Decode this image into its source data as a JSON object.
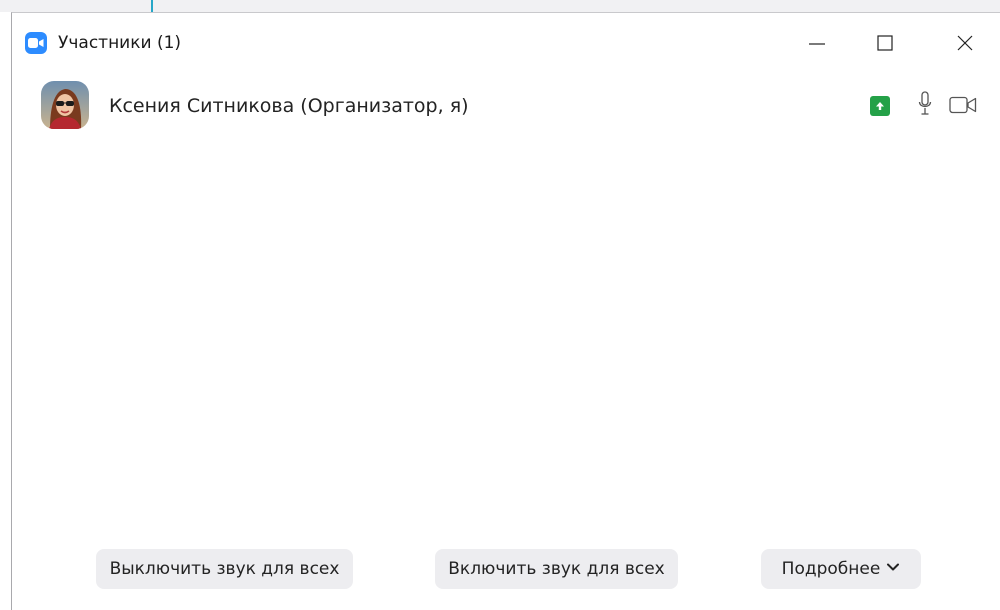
{
  "window": {
    "title": "Участники (1)",
    "icons": {
      "app": "zoom-camera-icon",
      "minimize": "minimize-icon",
      "maximize": "maximize-icon",
      "close": "close-icon"
    }
  },
  "participants": [
    {
      "name": "Ксения Ситникова (Организатор, я)",
      "icons": {
        "avatar": "user-photo-avatar",
        "share": "screen-share-icon",
        "mic": "microphone-icon",
        "video": "video-camera-icon"
      },
      "colors": {
        "share_badge": "#24a148"
      }
    }
  ],
  "footer": {
    "mute_all_label": "Выключить звук для всех",
    "unmute_all_label": "Включить звук для всех",
    "more_label": "Подробнее",
    "more_icon": "chevron-down-icon"
  },
  "colors": {
    "accent": "#2d8cff",
    "button_bg": "#ededf0"
  }
}
